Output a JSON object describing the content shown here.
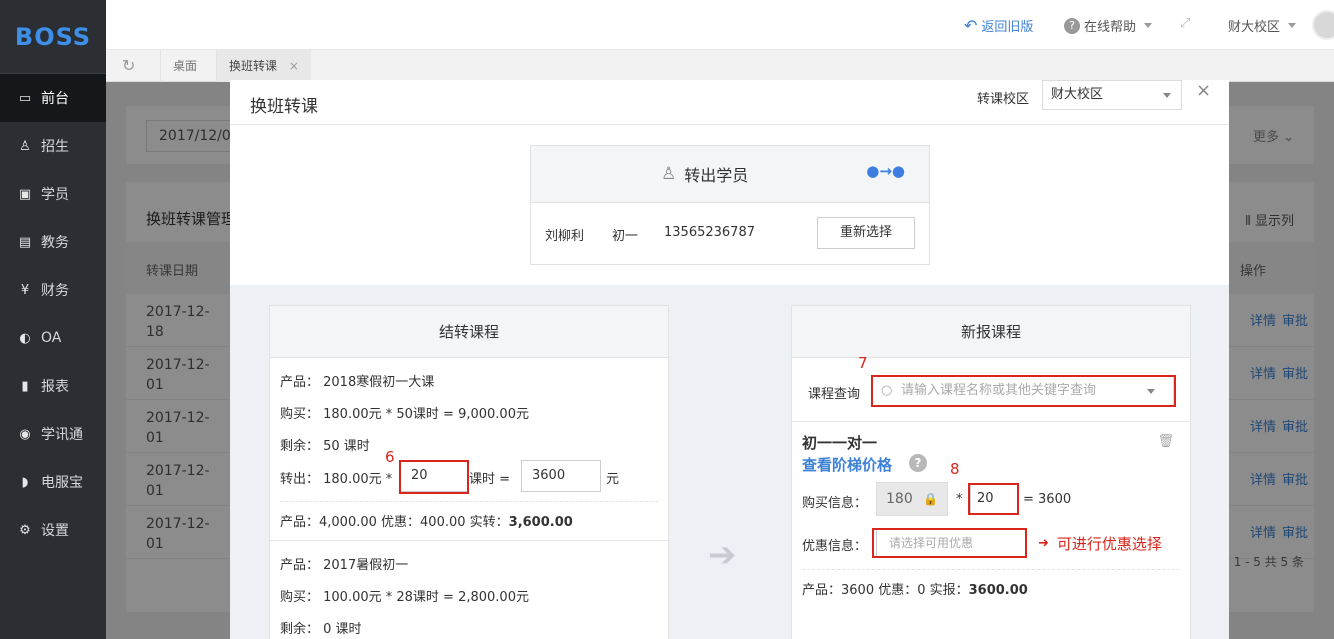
{
  "brand": "BOSS",
  "sidebar": {
    "items": [
      {
        "label": "前台",
        "icon": "calendar-icon",
        "glyph": "▭"
      },
      {
        "label": "招生",
        "icon": "user-add-icon",
        "glyph": "♙"
      },
      {
        "label": "学员",
        "icon": "id-card-icon",
        "glyph": "▣"
      },
      {
        "label": "教务",
        "icon": "book-icon",
        "glyph": "▤"
      },
      {
        "label": "财务",
        "icon": "yen-icon",
        "glyph": "¥"
      },
      {
        "label": "OA",
        "icon": "toggle-icon",
        "glyph": "◐"
      },
      {
        "label": "报表",
        "icon": "bar-chart-icon",
        "glyph": "▮"
      },
      {
        "label": "学讯通",
        "icon": "location-icon",
        "glyph": "◉"
      },
      {
        "label": "电服宝",
        "icon": "phone-icon",
        "glyph": "◗"
      },
      {
        "label": "设置",
        "icon": "gear-icon",
        "glyph": "⚙"
      }
    ]
  },
  "topbar": {
    "back_label": "返回旧版",
    "help_label": "在线帮助",
    "campus_label": "财大校区"
  },
  "tabs": {
    "desktop": "桌面",
    "current": "换班转课",
    "close_glyph": "×"
  },
  "background": {
    "date_value": "2017/12/0",
    "more_label": "更多",
    "panel_title": "换班转课管理",
    "show_columns": "显示列",
    "col_date": "转课日期",
    "col_action": "操作",
    "rows": [
      {
        "date": "2017-12-18"
      },
      {
        "date": "2017-12-01"
      },
      {
        "date": "2017-12-01"
      },
      {
        "date": "2017-12-01"
      },
      {
        "date": "2017-12-01"
      }
    ],
    "detail_label": "详情",
    "review_label": "审批",
    "pager": "1 - 5  共 5 条"
  },
  "modal": {
    "title": "换班转课",
    "transfer_campus_label": "转课校区",
    "transfer_campus_value": "财大校区",
    "close_glyph": "×",
    "student": {
      "header": "转出学员",
      "name": "刘柳利",
      "grade": "初一",
      "phone": "13565236787",
      "reselect": "重新选择"
    },
    "left": {
      "header": "结转课程",
      "c1_product": "产品： 2018寒假初一大课",
      "c1_buy": "购买： 180.00元 * 50课时 = 9,000.00元",
      "c1_remain": "剩余： 50 课时",
      "c1_out_prefix": "转出： 180.00元 *",
      "c1_out_hours": "20",
      "c1_out_mid": "课时 =",
      "c1_out_total": "3600",
      "c1_out_unit": "元",
      "c1_summary_a": "产品：4,000.00   优惠：400.00   实转：",
      "c1_summary_b": "3,600.00",
      "c2_product": "产品： 2017暑假初一",
      "c2_buy": "购买： 100.00元 * 28课时 = 2,800.00元",
      "c2_remain": "剩余： 0 课时",
      "annotation": "6"
    },
    "right": {
      "header": "新报课程",
      "search_label": "课程查询",
      "search_placeholder": "请输入课程名称或其他关键字查询",
      "annotation_search": "7",
      "course_name": "初一一对一",
      "tier_link": "查看阶梯价格",
      "buy_label": "购买信息：",
      "price": "180",
      "times": "*",
      "qty": "20",
      "equals": "= 3600",
      "annotation_qty": "8",
      "discount_label": "优惠信息：",
      "discount_placeholder": "请选择可用优惠",
      "discount_note": "可进行优惠选择",
      "summary_a": "产品：3600   优惠：0   实报：",
      "summary_b": "3600.00"
    }
  }
}
